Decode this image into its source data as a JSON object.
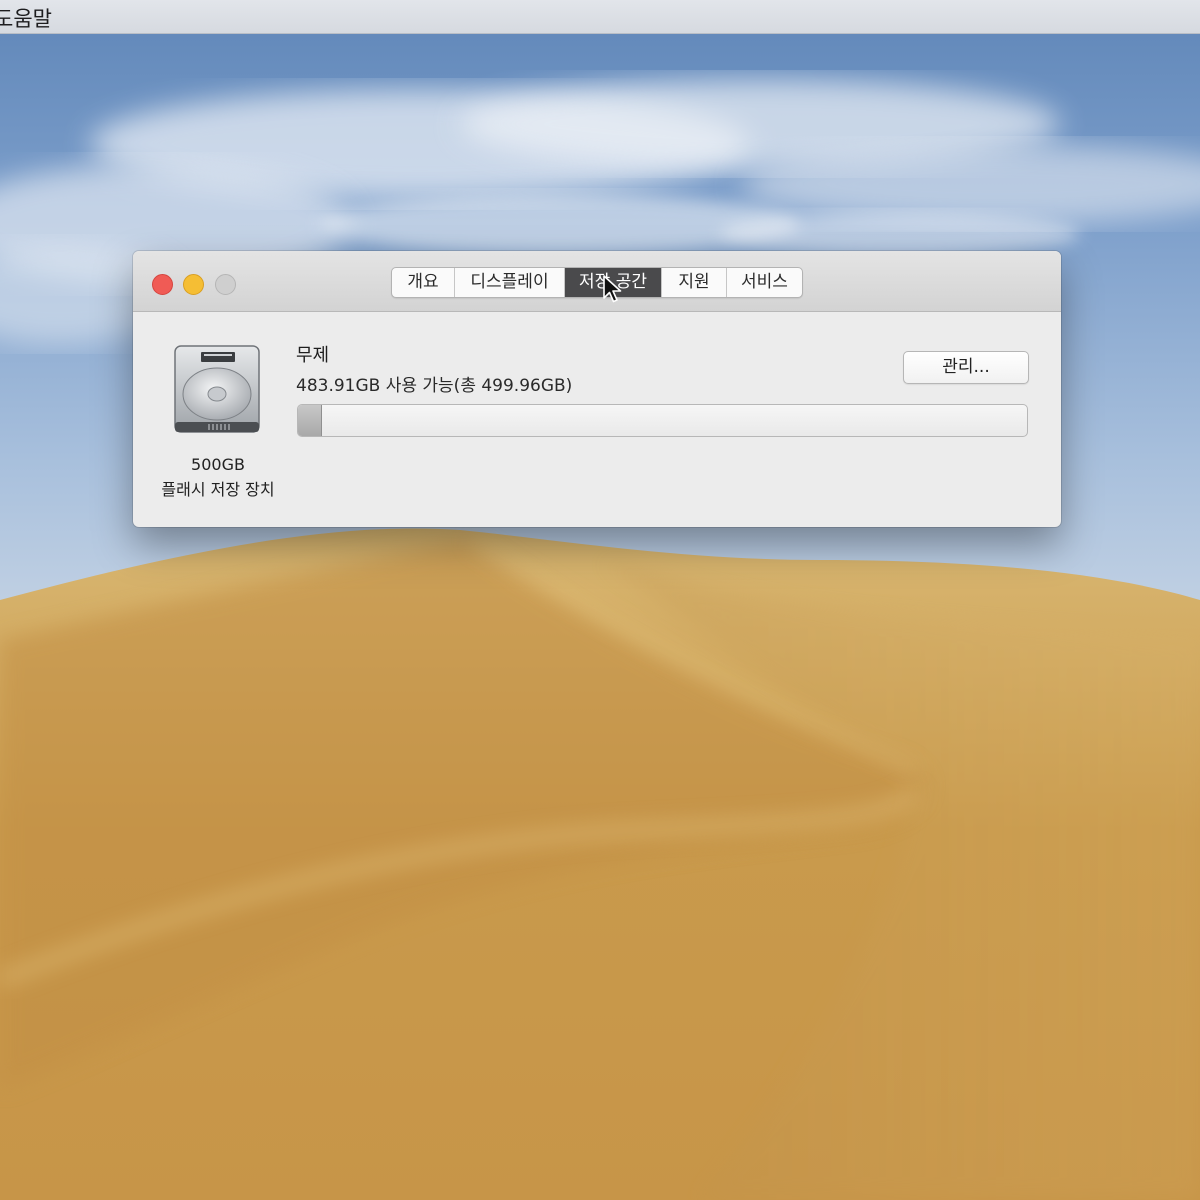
{
  "menubar": {
    "help_label": "도움말"
  },
  "window": {
    "tabs": [
      {
        "label": "개요"
      },
      {
        "label": "디스플레이"
      },
      {
        "label": "저장 공간",
        "selected": true
      },
      {
        "label": "지원"
      },
      {
        "label": "서비스"
      }
    ],
    "disk": {
      "size_label": "500GB",
      "type_label": "플래시 저장 장치",
      "icon": "hard-drive-icon"
    },
    "volume": {
      "name": "무제",
      "availability": "483.91GB 사용 가능(총 499.96GB)",
      "used_fraction": 0.032
    },
    "manage_button_label": "관리..."
  },
  "colors": {
    "close": "#f05b55",
    "minimize": "#f5be34",
    "zoom_disabled": "#cfcfcf",
    "selected_tab": "#4a4a4c"
  }
}
